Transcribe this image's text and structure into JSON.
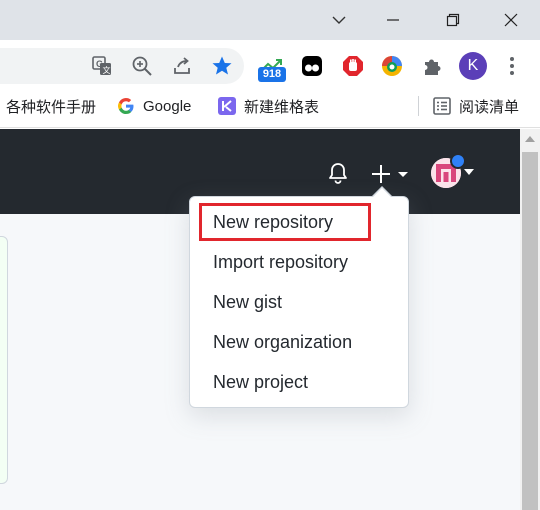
{
  "browser": {
    "bookmarks": [
      {
        "label": "各种软件手册",
        "icon": "partial-bookmark"
      },
      {
        "label": "Google",
        "icon": "google-icon"
      },
      {
        "label": "新建维格表",
        "icon": "vika-icon"
      }
    ],
    "reading_list_label": "阅读清单",
    "extension_badge": "918",
    "profile_initial": "K",
    "accent_color": "#1a73e8"
  },
  "github": {
    "header_color": "#24292f",
    "new_menu": {
      "items": [
        {
          "label": "New repository",
          "highlighted": true
        },
        {
          "label": "Import repository"
        },
        {
          "label": "New gist"
        },
        {
          "label": "New organization"
        },
        {
          "label": "New project"
        }
      ],
      "highlight_color": "#e1262d"
    }
  }
}
